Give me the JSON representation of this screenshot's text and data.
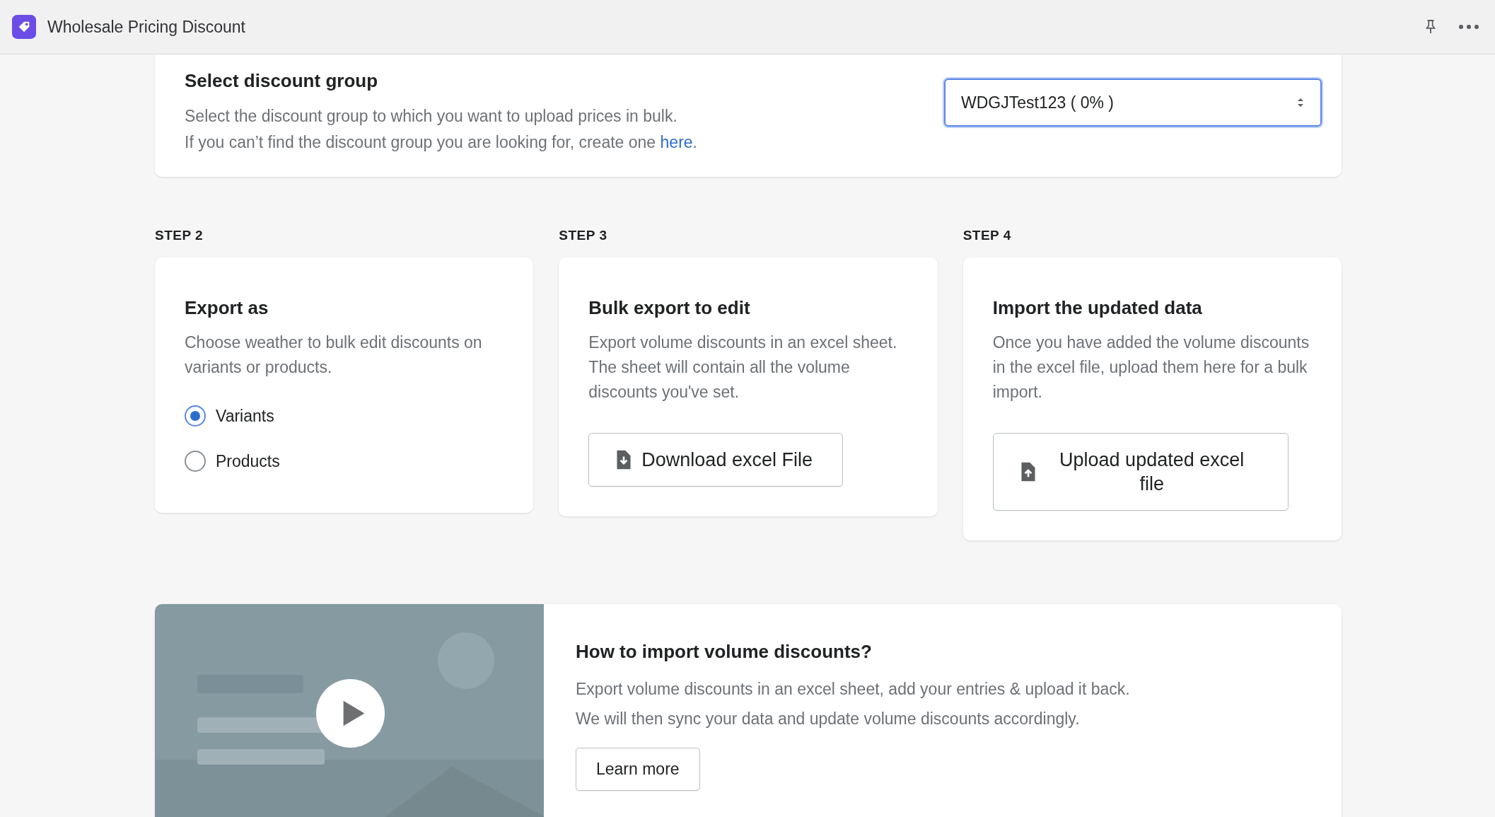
{
  "app_bar": {
    "title": "Wholesale Pricing Discount"
  },
  "discount_group": {
    "title": "Select discount group",
    "description": "Select the discount group to which you want to upload prices in bulk.",
    "hint_before": "If you can’t find the discount group you are looking for, create one ",
    "hint_link": "here",
    "hint_after": ".",
    "select": {
      "value": "WDGJTest123 ( 0% )",
      "focused": true
    }
  },
  "steps": [
    {
      "kind": "radio",
      "label": "STEP 2",
      "title": "Export as",
      "description": "Choose weather to bulk edit discounts on variants or products.",
      "options": [
        {
          "label": "Variants",
          "selected": true
        },
        {
          "label": "Products",
          "selected": false
        }
      ]
    },
    {
      "kind": "button",
      "label": "STEP 3",
      "title": "Bulk export to edit",
      "description": "Export volume discounts in an excel sheet. The sheet will contain all the volume discounts you've set.",
      "button": {
        "label": "Download excel File",
        "kind": "download"
      }
    },
    {
      "kind": "button",
      "label": "STEP 4",
      "title": "Import the updated data",
      "description": "Once you have added the volume discounts in the excel file, upload them here for a bulk import.",
      "button": {
        "label": "Upload updated excel file",
        "kind": "upload"
      }
    }
  ],
  "help": {
    "video": {
      "kind": "picture"
    },
    "title": "How to import volume discounts?",
    "lines": [
      "Export volume discounts in an excel sheet, add your entries & upload it back.",
      "We will then sync your data and update volume discounts accordingly."
    ],
    "button": "Learn more"
  }
}
